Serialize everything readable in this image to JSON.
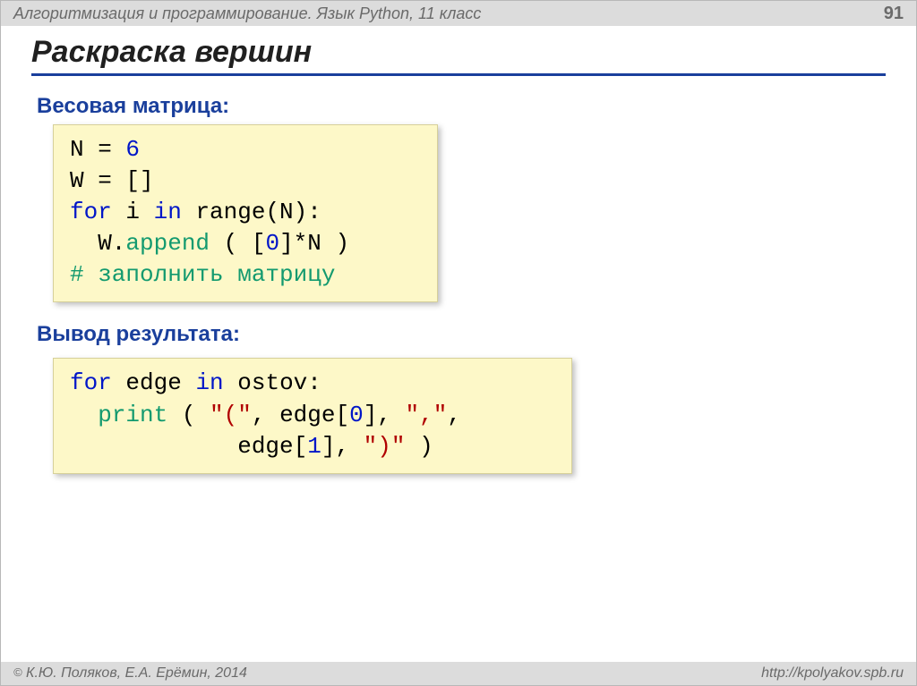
{
  "header": {
    "course": "Алгоритмизация и программирование. Язык Python, 11 класс",
    "page": "91"
  },
  "title": "Раскраска вершин",
  "sections": {
    "matrix_label": "Весовая матрица:",
    "output_label": "Вывод результата:"
  },
  "code1": {
    "l1a": "N",
    "l1b": " = ",
    "l1c": "6",
    "l2": "W = []",
    "l3a": "for",
    "l3b": " i ",
    "l3c": "in",
    "l3d": " range(N):",
    "l4a": "  W.",
    "l4b": "append",
    "l4c": " ( [",
    "l4d": "0",
    "l4e": "]*N )",
    "l5": "# заполнить матрицу"
  },
  "code2": {
    "l1a": "for",
    "l1b": " edge ",
    "l1c": "in",
    "l1d": " ostov:",
    "l2a": "  ",
    "l2b": "print",
    "l2c": " ( ",
    "l2d": "\"(\"",
    "l2e": ", edge[",
    "l2f": "0",
    "l2g": "], ",
    "l2h": "\",\"",
    "l2i": ",",
    "l3a": "            edge[",
    "l3b": "1",
    "l3c": "], ",
    "l3d": "\")\"",
    "l3e": " )"
  },
  "footer": {
    "copyright_symbol": "©",
    "authors": " К.Ю. Поляков, Е.А. Ерёмин, 2014",
    "url": "http://kpolyakov.spb.ru"
  }
}
